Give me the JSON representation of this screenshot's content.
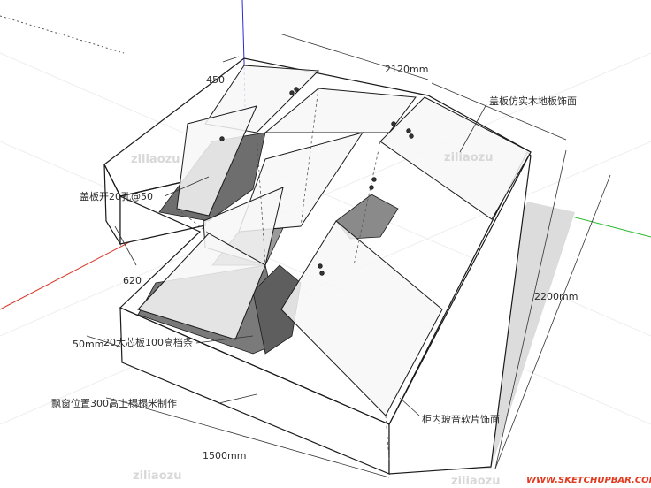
{
  "diagram": {
    "dimensions": {
      "top_length": "2120mm",
      "right_length": "2200mm",
      "bottom_length": "1500mm",
      "top_left_depth": "450",
      "left_depth": "620",
      "board_thickness": "50mm"
    },
    "annotations": {
      "lid_finish": "盖板仿实木地板饰面",
      "lid_holes": "盖板开20孔@50",
      "partition": "20大芯板100高档条",
      "bay_window": "飘窗位置300高上榻榻米制作",
      "cabinet_inside": "柜内玻音软片饰面"
    },
    "watermark": "ziliaozu",
    "brand": "WWW.SKETCHUPBAR.COM",
    "colors": {
      "line": "#1a1a1a",
      "shadow": "#d9d9d9",
      "dark_floor": "#6e6e6e",
      "axis_blue": "#2a2ad8",
      "axis_red": "#d83a2a",
      "axis_green": "#2ab82a",
      "brand_red": "#e23a1f"
    }
  }
}
